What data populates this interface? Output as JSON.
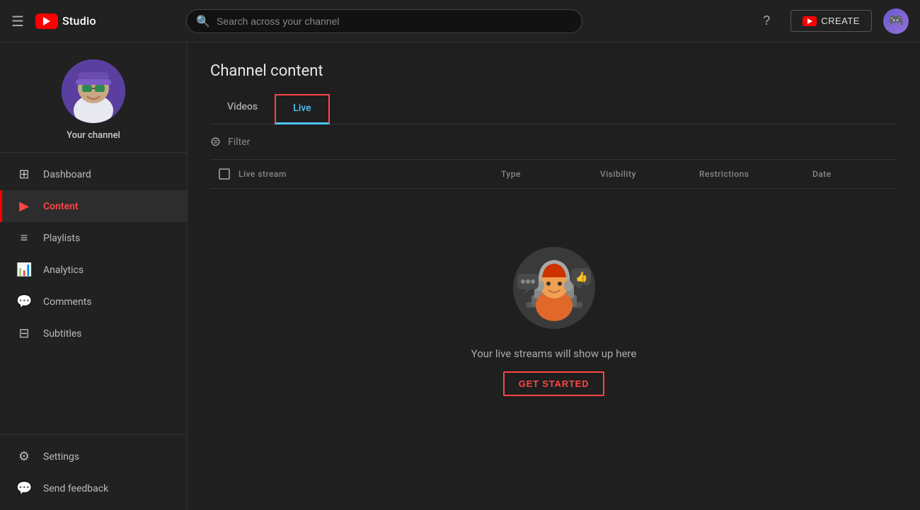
{
  "topnav": {
    "logo_text": "Studio",
    "search_placeholder": "Search across your channel",
    "help_icon": "?",
    "create_label": "CREATE",
    "avatar_emoji": "🎮"
  },
  "sidebar": {
    "channel_name": "Your channel",
    "nav_items": [
      {
        "id": "dashboard",
        "label": "Dashboard",
        "icon": "⊞",
        "active": false
      },
      {
        "id": "content",
        "label": "Content",
        "icon": "▶",
        "active": true
      },
      {
        "id": "playlists",
        "label": "Playlists",
        "icon": "≡",
        "active": false
      },
      {
        "id": "analytics",
        "label": "Analytics",
        "icon": "📊",
        "active": false
      },
      {
        "id": "comments",
        "label": "Comments",
        "icon": "💬",
        "active": false
      },
      {
        "id": "subtitles",
        "label": "Subtitles",
        "icon": "⊟",
        "active": false
      }
    ],
    "bottom_items": [
      {
        "id": "settings",
        "label": "Settings",
        "icon": "⚙",
        "active": false
      },
      {
        "id": "feedback",
        "label": "Send feedback",
        "icon": "💬",
        "active": false
      }
    ]
  },
  "content": {
    "page_title": "Channel content",
    "tabs": [
      {
        "id": "videos",
        "label": "Videos",
        "active": false
      },
      {
        "id": "live",
        "label": "Live",
        "active": true
      }
    ],
    "filter_label": "Filter",
    "table": {
      "columns": [
        {
          "id": "stream",
          "label": "Live stream"
        },
        {
          "id": "type",
          "label": "Type"
        },
        {
          "id": "visibility",
          "label": "Visibility"
        },
        {
          "id": "restrictions",
          "label": "Restrictions"
        },
        {
          "id": "date",
          "label": "Date"
        }
      ]
    },
    "empty_state": {
      "message": "Your live streams will show up here",
      "cta_label": "GET STARTED"
    }
  }
}
